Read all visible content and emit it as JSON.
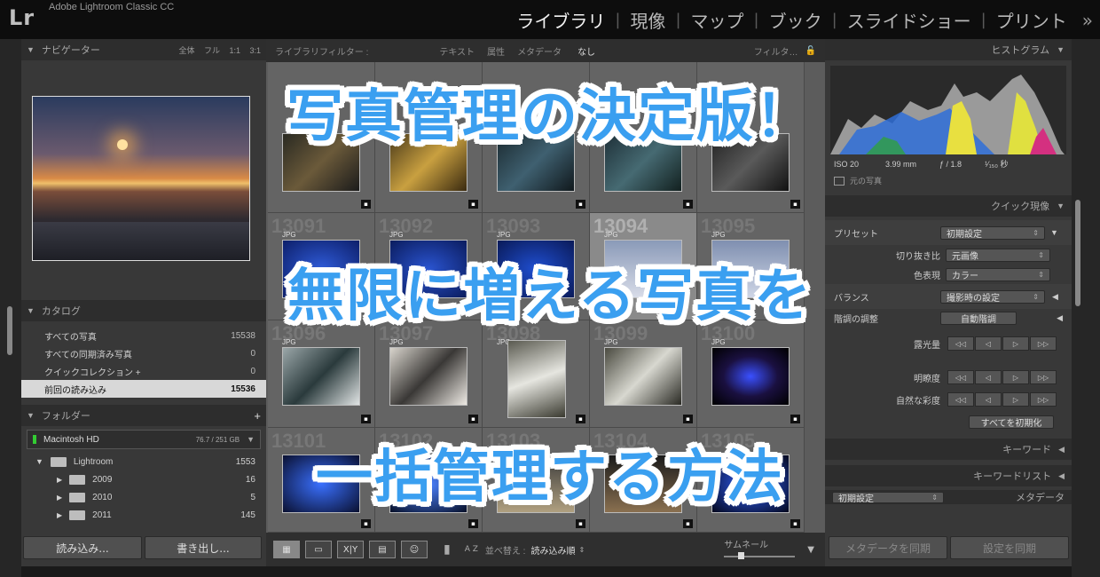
{
  "app": {
    "logo": "Lr",
    "name": "Adobe Lightroom Classic CC"
  },
  "modules": [
    "ライブラリ",
    "現像",
    "マップ",
    "ブック",
    "スライドショー",
    "プリント"
  ],
  "modules_more": "»",
  "left": {
    "navigator": {
      "title": "ナビゲーター",
      "options": "全体 フル 1:1 3:1"
    },
    "catalog": {
      "title": "カタログ",
      "items": [
        {
          "label": "すべての写真",
          "count": "15538"
        },
        {
          "label": "すべての同期済み写真",
          "count": "0"
        },
        {
          "label": "クイックコレクション +",
          "count": "0"
        },
        {
          "label": "前回の読み込み",
          "count": "15536"
        }
      ]
    },
    "folders": {
      "title": "フォルダー",
      "plus": "+",
      "drive": {
        "name": "Macintosh HD",
        "space": "76.7 / 251 GB"
      },
      "items": [
        {
          "name": "Lightroom",
          "count": "1553"
        },
        {
          "name": "2009",
          "count": "16"
        },
        {
          "name": "2010",
          "count": "5"
        },
        {
          "name": "2011",
          "count": "145"
        }
      ]
    },
    "import_button": "読み込み...",
    "export_button": "書き出し..."
  },
  "filter": {
    "label": "ライブラリフィルター :",
    "tabs": [
      "テキスト",
      "属性",
      "メタデータ",
      "なし"
    ],
    "preset": "フィルタ…"
  },
  "grid": {
    "row2": [
      {
        "num": "13091",
        "ext": "JPG"
      },
      {
        "num": "13092",
        "ext": "JPG"
      },
      {
        "num": "13093",
        "ext": "JPG"
      },
      {
        "num": "13094",
        "ext": "JPG"
      },
      {
        "num": "13095",
        "ext": "JPG"
      }
    ],
    "row3": [
      {
        "num": "13096",
        "ext": "JPG"
      },
      {
        "num": "13097",
        "ext": "JPG"
      },
      {
        "num": "13098",
        "ext": "JPG"
      },
      {
        "num": "13099",
        "ext": "JPG"
      },
      {
        "num": "13100",
        "ext": "JPG"
      }
    ],
    "row4": [
      {
        "num": "13101"
      },
      {
        "num": "13102"
      },
      {
        "num": "13103"
      },
      {
        "num": "13104"
      },
      {
        "num": "13105"
      }
    ]
  },
  "toolbar": {
    "sort_label": "並べ替え :",
    "sort_value": "読み込み順",
    "thumb_label": "サムネール",
    "xy": "X|Y",
    "az": "A Z"
  },
  "right": {
    "histogram": {
      "title": "ヒストグラム",
      "iso": "ISO 20",
      "focal": "3.99 mm",
      "aperture": "ƒ / 1.8",
      "shutter": "¹⁄₁₅₀ 秒",
      "original": "元の写真"
    },
    "quick_develop": {
      "title": "クイック現像",
      "preset_label": "プリセット",
      "preset_value": "初期設定",
      "crop_label": "切り抜き比",
      "crop_value": "元画像",
      "color_label": "色表現",
      "color_value": "カラー",
      "wb_label": "バランス",
      "wb_value": "撮影時の設定",
      "tone_label": "階調の調整",
      "tone_value": "自動階調",
      "exposure_label": "露光量",
      "clarity_label": "明瞭度",
      "vibrance_label": "自然な彩度",
      "reset_button": "すべてを初期化",
      "steps": [
        "◁◁",
        "◁",
        "▷",
        "▷▷"
      ]
    },
    "keyword": "キーワード",
    "keyword_list": "キーワードリスト",
    "metadata": "メタデータ",
    "metadata_preset": "初期設定",
    "sync_metadata": "メタデータを同期",
    "sync_settings": "設定を同期"
  },
  "headlines": [
    "写真管理の決定版！",
    "無限に増える写真を",
    "一括管理する方法"
  ],
  "colors": {
    "headline": "#3a9ff0",
    "selection": "#d8d8d8",
    "panel": "#383838",
    "grid": "#646464"
  }
}
